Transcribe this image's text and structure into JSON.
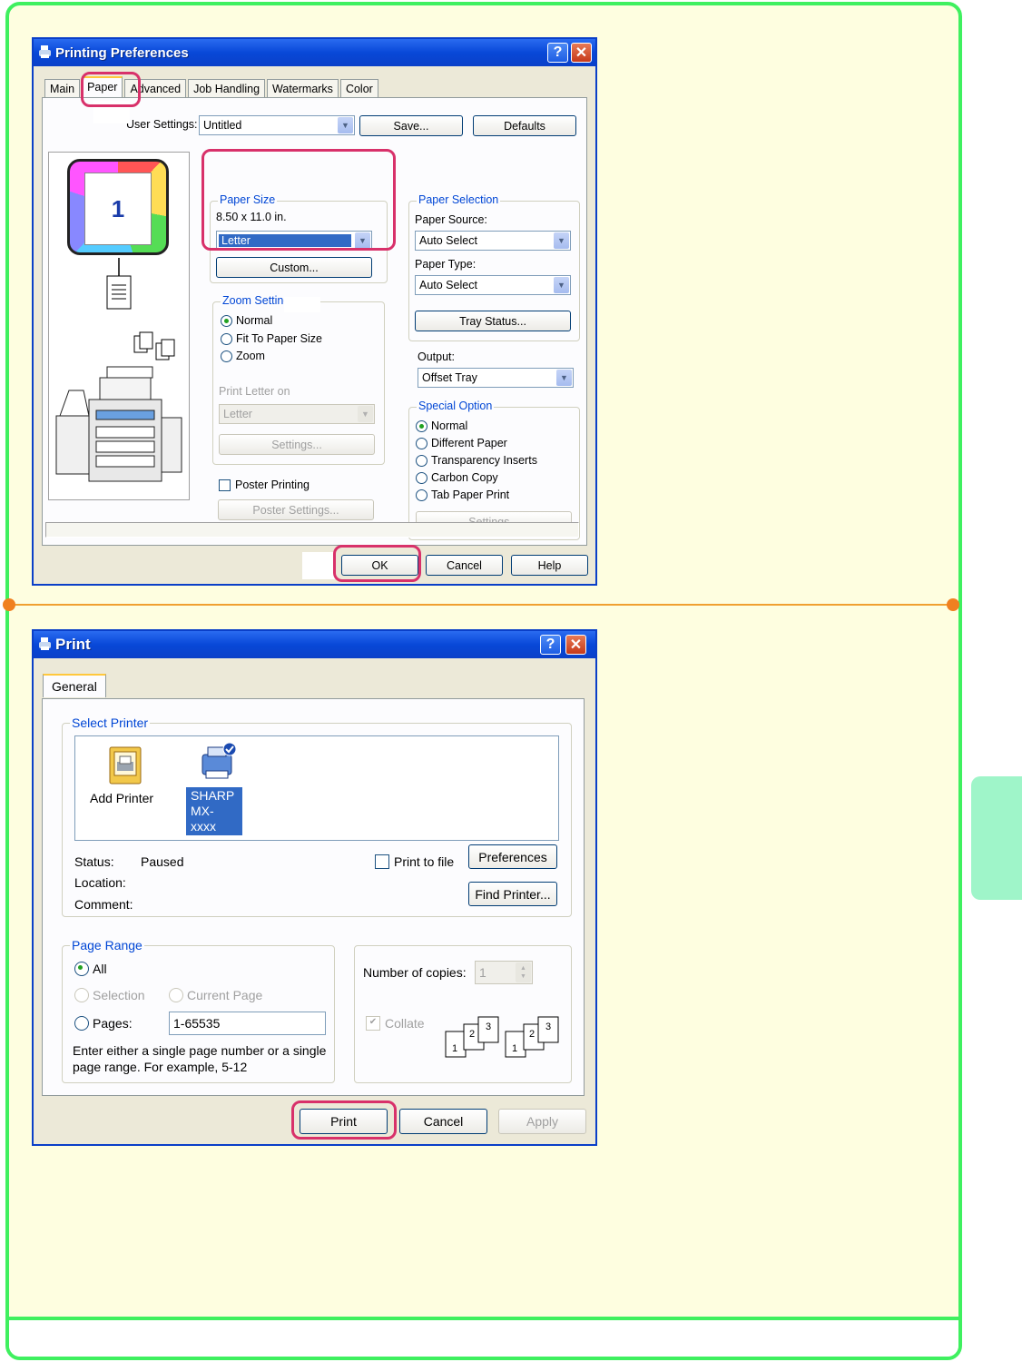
{
  "dialog1": {
    "title": "Printing Preferences",
    "tabs": [
      "Main",
      "Paper",
      "Advanced",
      "Job Handling",
      "Watermarks",
      "Color"
    ],
    "user_settings_label": "User Settings:",
    "user_settings_value": "Untitled",
    "save_button": "Save...",
    "defaults_button": "Defaults",
    "preview_page_number": "1",
    "paper_size": {
      "label": "Paper Size",
      "dimensions": "8.50 x 11.0 in.",
      "selected": "Letter",
      "custom_button": "Custom..."
    },
    "zoom_setting": {
      "label": "Zoom Setting",
      "options": [
        "Normal",
        "Fit To Paper Size",
        "Zoom"
      ],
      "selected": "Normal",
      "print_on_label": "Print Letter on",
      "print_on_value": "Letter",
      "settings_button": "Settings..."
    },
    "poster_printing": {
      "label": "Poster Printing",
      "checked": false,
      "settings_button": "Poster Settings..."
    },
    "paper_selection": {
      "label": "Paper Selection",
      "source_label": "Paper Source:",
      "source_value": "Auto Select",
      "type_label": "Paper Type:",
      "type_value": "Auto Select",
      "tray_status_button": "Tray Status..."
    },
    "output": {
      "label": "Output:",
      "value": "Offset Tray"
    },
    "special_option": {
      "label": "Special Option",
      "options": [
        "Normal",
        "Different Paper",
        "Transparency Inserts",
        "Carbon Copy",
        "Tab Paper Print"
      ],
      "selected": "Normal",
      "settings_button": "Settings..."
    },
    "ok_button": "OK",
    "cancel_button": "Cancel",
    "help_button": "Help"
  },
  "dialog2": {
    "title": "Print",
    "tab": "General",
    "select_printer": {
      "label": "Select Printer",
      "items": [
        {
          "name": "Add Printer",
          "icon": "add-printer-icon"
        },
        {
          "name": "SHARP MX-xxxx",
          "icon": "printer-icon",
          "line1": "SHARP",
          "line2": "MX-xxxx",
          "selected": true
        }
      ]
    },
    "status_label": "Status:",
    "status_value": "Paused",
    "location_label": "Location:",
    "comment_label": "Comment:",
    "print_to_file_label": "Print to file",
    "preferences_button": "Preferences",
    "find_printer_button": "Find Printer...",
    "page_range": {
      "label": "Page Range",
      "all": "All",
      "selection": "Selection",
      "current_page": "Current Page",
      "pages": "Pages:",
      "pages_value": "1-65535",
      "help_line1": "Enter either a single page number or a single",
      "help_line2": "page range.  For example, 5-12"
    },
    "copies_label": "Number of copies:",
    "copies_value": "1",
    "collate_label": "Collate",
    "print_button": "Print",
    "cancel_button": "Cancel",
    "apply_button": "Apply"
  },
  "colors": {
    "page_border": "#3ff05f",
    "page_background": "#fefee0",
    "divider": "#f0a030",
    "highlight": "#d8316a",
    "side_tab": "#9ff5c9",
    "titlebar": "#0a4bd8"
  }
}
